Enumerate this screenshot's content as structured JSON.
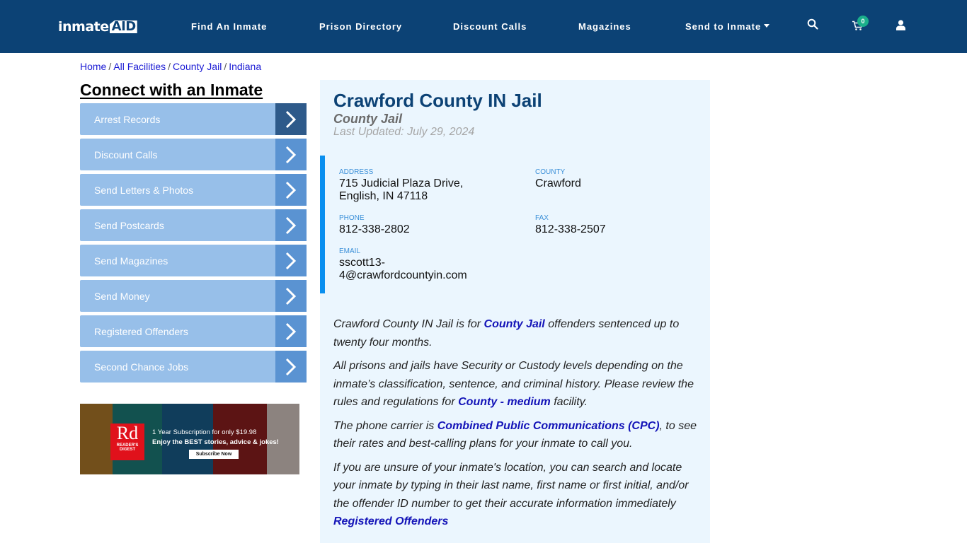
{
  "header": {
    "logo_text": "inmate",
    "logo_accent": "AID",
    "nav": [
      {
        "label": "Find An Inmate"
      },
      {
        "label": "Prison Directory"
      },
      {
        "label": "Discount Calls"
      },
      {
        "label": "Magazines"
      },
      {
        "label": "Send to Inmate"
      }
    ],
    "cart_count": "0",
    "icons": [
      "search-icon",
      "cart-icon",
      "user-icon"
    ],
    "colors": {
      "bar": "#0c4275",
      "badge": "#1aaf8b"
    }
  },
  "breadcrumb": [
    "Home",
    "All Facilities",
    "County Jail",
    "Indiana"
  ],
  "sidebar": {
    "title": "Connect with an Inmate",
    "items": [
      {
        "label": "Arrest Records"
      },
      {
        "label": "Discount Calls"
      },
      {
        "label": "Send Letters & Photos"
      },
      {
        "label": "Send Postcards"
      },
      {
        "label": "Send Magazines"
      },
      {
        "label": "Send Money"
      },
      {
        "label": "Registered Offenders"
      },
      {
        "label": "Second Chance Jobs"
      }
    ],
    "ad": {
      "brand_short": "Rd",
      "brand_line1": "READER'S",
      "brand_line2": "DIGEST",
      "line1": "1 Year Subscription for only $19.98",
      "line2": "Enjoy the BEST stories, advice & jokes!",
      "cta": "Subscribe Now"
    }
  },
  "facility": {
    "name": "Crawford County IN Jail",
    "type": "County Jail",
    "last_updated": "Last Updated: July 29, 2024",
    "address_label": "Address",
    "address_line1": "715 Judicial Plaza Drive,",
    "address_line2": "English, IN 47118",
    "county_label": "County",
    "county": "Crawford",
    "phone_label": "Phone",
    "phone": "812-338-2802",
    "fax_label": "Fax",
    "fax": "812-338-2507",
    "email_label": "Email",
    "email_line1": "sscott13-",
    "email_line2": "4@crawfordcountyin.com"
  },
  "content": {
    "p1_a": "Crawford County IN Jail is for ",
    "p1_link": "County Jail",
    "p1_b": " offenders sentenced up to twenty four months.",
    "p2_a": "All prisons and jails have Security or Custody levels depending on the inmate’s classification, sentence, and criminal history. Please review the rules and regulations for ",
    "p2_link": "County - medium",
    "p2_b": " facility.",
    "p3_a": "The phone carrier is ",
    "p3_link": "Combined Public Communications (CPC)",
    "p3_b": ", to see their rates and best-calling plans for your inmate to call you.",
    "p4_a": "If you are unsure of your inmate's location, you can search and locate your inmate by typing in their last name, first name or first initial, and/or the offender ID number to get their accurate information immediately",
    "p4_link": "Registered Offenders"
  }
}
